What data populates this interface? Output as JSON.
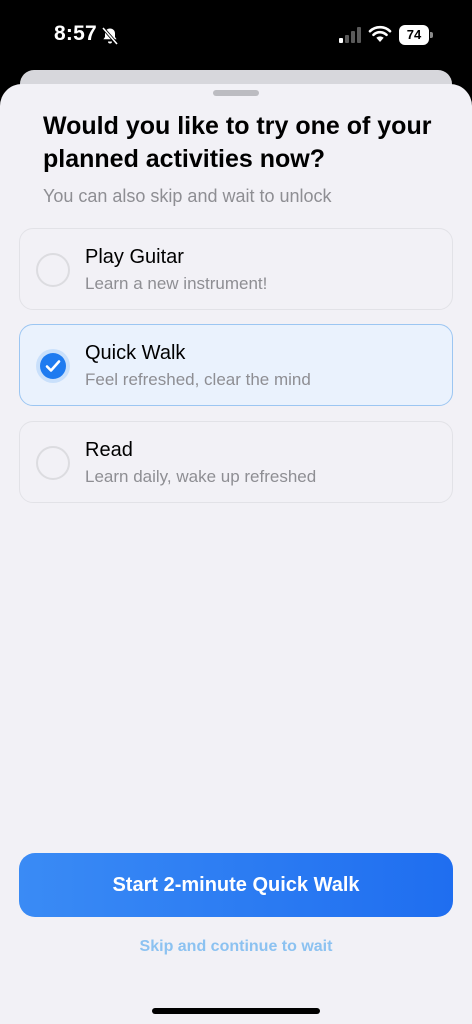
{
  "status_bar": {
    "time": "8:57",
    "battery_level": "74",
    "icons": [
      "bell-slash-icon",
      "cellular-signal-icon",
      "wifi-icon",
      "battery-icon"
    ]
  },
  "sheet": {
    "title": "Would you like to try one of your planned activities now?",
    "subtitle": "You can also skip and wait to unlock",
    "options": [
      {
        "title": "Play Guitar",
        "subtitle": "Learn a new instrument!",
        "selected": false
      },
      {
        "title": "Quick Walk",
        "subtitle": "Feel refreshed, clear the mind",
        "selected": true
      },
      {
        "title": "Read",
        "subtitle": "Learn daily, wake up refreshed",
        "selected": false
      }
    ],
    "primary_button": "Start 2-minute Quick Walk",
    "skip_link": "Skip and continue to wait"
  },
  "colors": {
    "accent": "#1e7bf0",
    "button_gradient_start": "#3a8bf5",
    "button_gradient_end": "#1f6ef0",
    "sheet_background": "#f2f1f6",
    "secondary_text": "#8e8e93",
    "link": "#8cc2f1"
  }
}
